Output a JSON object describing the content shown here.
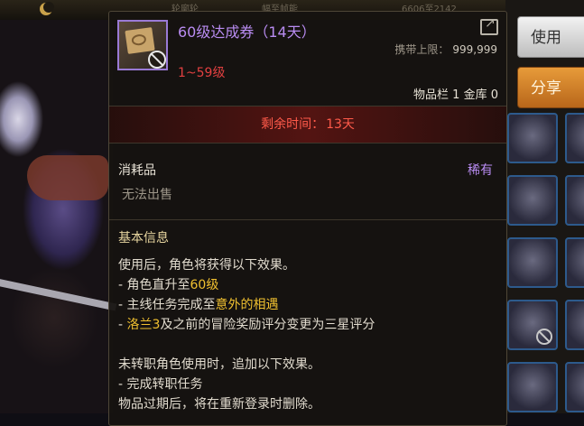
{
  "topbar": {
    "left_text": "轮廓轮",
    "mid_text": "幅至帧能",
    "right_text": "6606至2142"
  },
  "buttons": {
    "use_label": "使用",
    "share_label": "分享"
  },
  "item": {
    "name": "60级达成券（14天）",
    "name_color": "#b98cf2",
    "icon": "coupon-book-icon",
    "carry_limit_label": "携带上限：",
    "carry_limit_value": "999,999",
    "level_range": "1~59级",
    "storage_text": "物品栏 1 金库 0",
    "remaining_label": "剩余时间：",
    "remaining_value": "13天",
    "category": "消耗品",
    "rarity": "稀有",
    "trade_restriction": "无法出售",
    "section_title": "基本信息",
    "desc_intro": "使用后，角色将获得以下效果。",
    "effect1_prefix": "- 角色直升至",
    "effect1_highlight": "60级",
    "effect2_prefix": "- 主线任务完成至",
    "effect2_highlight": "意外的相遇",
    "effect3_prefix": "- ",
    "effect3_highlight": "洛兰3",
    "effect3_suffix": "及之前的冒险奖励评分变更为三星评分",
    "desc_intro2": "未转职角色使用时，追加以下效果。",
    "effect4": "- 完成转职任务",
    "expiry_note": "物品过期后，将在重新登录时删除。"
  }
}
